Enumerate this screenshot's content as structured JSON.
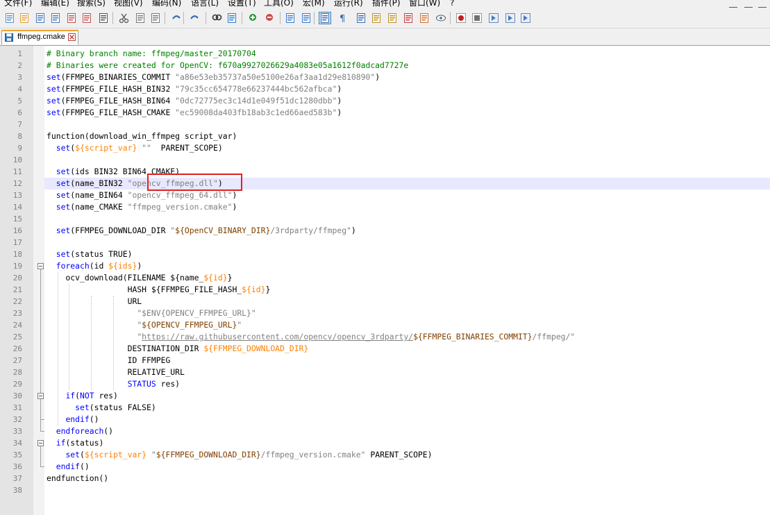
{
  "menu": [
    "文件(F)",
    "编辑(E)",
    "搜索(S)",
    "视图(V)",
    "编码(N)",
    "语言(L)",
    "设置(T)",
    "工具(O)",
    "宏(M)",
    "运行(R)",
    "插件(P)",
    "窗口(W)",
    "?"
  ],
  "toolbar_icons": [
    "new-file-icon",
    "open-file-icon",
    "save-icon",
    "save-all-icon",
    "close-icon",
    "close-all-icon",
    "print-icon",
    "cut-icon",
    "copy-icon",
    "paste-icon",
    "undo-icon",
    "redo-icon",
    "find-icon",
    "replace-icon",
    "zoom-in-icon",
    "zoom-out-icon",
    "sync-vertical-icon",
    "sync-horizontal-icon",
    "word-wrap-icon",
    "show-all-chars-icon",
    "indent-guide-icon",
    "udl-icon",
    "doc-map-icon",
    "function-list-icon",
    "folder-workspace-icon",
    "monitor-icon",
    "record-macro-icon",
    "stop-record-icon",
    "play-macro-icon",
    "play-multiple-icon",
    "save-macro-icon"
  ],
  "tab": {
    "label": "ffmpeg.cmake",
    "color_active": "#f0a030"
  },
  "colors": {
    "keyword": "#0000ff",
    "comment": "#008000",
    "string": "#808080",
    "variable": "#ff8000",
    "current_line": "#e8e8ff",
    "annotation_box": "#e02020"
  },
  "line_numbers": [
    "1",
    "2",
    "3",
    "4",
    "5",
    "6",
    "7",
    "8",
    "9",
    "10",
    "11",
    "12",
    "13",
    "14",
    "15",
    "16",
    "17",
    "18",
    "19",
    "20",
    "21",
    "22",
    "23",
    "24",
    "25",
    "26",
    "27",
    "28",
    "29",
    "30",
    "31",
    "32",
    "33",
    "34",
    "35",
    "36",
    "37",
    "38"
  ],
  "code_lines": [
    [
      [
        "cm",
        "# Binary branch name: ffmpeg/master_20170704"
      ]
    ],
    [
      [
        "cm",
        "# Binaries were created for OpenCV: f670a9927026629a4083e05a1612f0adcad7727e"
      ]
    ],
    [
      [
        "kw",
        "set"
      ],
      [
        "",
        "(FFMPEG_BINARIES_COMMIT "
      ],
      [
        "st",
        "\"a86e53eb35737a50e5100e26af3aa1d29e810890\""
      ],
      [
        "",
        ")"
      ]
    ],
    [
      [
        "kw",
        "set"
      ],
      [
        "",
        "(FFMPEG_FILE_HASH_BIN32 "
      ],
      [
        "st",
        "\"79c35cc654778e66237444bc562afbca\""
      ],
      [
        "",
        ")"
      ]
    ],
    [
      [
        "kw",
        "set"
      ],
      [
        "",
        "(FFMPEG_FILE_HASH_BIN64 "
      ],
      [
        "st",
        "\"0dc72775ec3c14d1e049f51dc1280dbb\""
      ],
      [
        "",
        ")"
      ]
    ],
    [
      [
        "kw",
        "set"
      ],
      [
        "",
        "(FFMPEG_FILE_HASH_CMAKE "
      ],
      [
        "st",
        "\"ec59008da403fb18ab3c1ed66aed583b\""
      ],
      [
        "",
        ")"
      ]
    ],
    [
      [
        "",
        ""
      ]
    ],
    [
      [
        "",
        "function(download_win_ffmpeg script_var)"
      ]
    ],
    [
      [
        "",
        "  "
      ],
      [
        "kw",
        "set"
      ],
      [
        "",
        "("
      ],
      [
        "vr",
        "${script_var}"
      ],
      [
        "st",
        " \"\""
      ],
      [
        "",
        ""
      ],
      [
        "",
        "  PARENT_SCOPE)"
      ]
    ],
    [
      [
        "",
        ""
      ]
    ],
    [
      [
        "",
        "  "
      ],
      [
        "kw",
        "set"
      ],
      [
        "",
        "(ids BIN32 BIN64 CMAKE)"
      ]
    ],
    [
      [
        "",
        "  "
      ],
      [
        "kw",
        "set"
      ],
      [
        "",
        "(name_BIN32 "
      ],
      [
        "st",
        "\"opencv_ffmpeg.dll\""
      ],
      [
        "",
        ")"
      ]
    ],
    [
      [
        "",
        "  "
      ],
      [
        "kw",
        "set"
      ],
      [
        "",
        "(name_BIN64 "
      ],
      [
        "st",
        "\"opencv_ffmpeg_64.dll\""
      ],
      [
        "",
        ")"
      ]
    ],
    [
      [
        "",
        "  "
      ],
      [
        "kw",
        "set"
      ],
      [
        "",
        "(name_CMAKE "
      ],
      [
        "st",
        "\"ffmpeg_version.cmake\""
      ],
      [
        "",
        ")"
      ]
    ],
    [
      [
        "",
        ""
      ]
    ],
    [
      [
        "",
        "  "
      ],
      [
        "kw",
        "set"
      ],
      [
        "",
        "(FFMPEG_DOWNLOAD_DIR "
      ],
      [
        "st",
        "\""
      ],
      [
        "bvr",
        "${OpenCV_BINARY_DIR}"
      ],
      [
        "st",
        "/3rdparty/ffmpeg\""
      ],
      [
        "",
        ")"
      ]
    ],
    [
      [
        "",
        ""
      ]
    ],
    [
      [
        "",
        "  "
      ],
      [
        "kw",
        "set"
      ],
      [
        "",
        "(status TRUE)"
      ]
    ],
    [
      [
        "",
        "  "
      ],
      [
        "kw",
        "foreach"
      ],
      [
        "",
        "(id "
      ],
      [
        "vr",
        "${ids}"
      ],
      [
        "",
        ")"
      ]
    ],
    [
      [
        "",
        "    ocv_download(FILENAME ${name_"
      ],
      [
        "vr",
        "${id}"
      ],
      [
        "",
        "}"
      ]
    ],
    [
      [
        "",
        "                 HASH ${FFMPEG_FILE_HASH_"
      ],
      [
        "vr",
        "${id}"
      ],
      [
        "",
        "}"
      ]
    ],
    [
      [
        "",
        "                 URL"
      ]
    ],
    [
      [
        "",
        "                   "
      ],
      [
        "st",
        "\"$ENV{OPENCV_FFMPEG_URL}\""
      ]
    ],
    [
      [
        "",
        "                   "
      ],
      [
        "st",
        "\""
      ],
      [
        "bvr",
        "${OPENCV_FFMPEG_URL}"
      ],
      [
        "st",
        "\""
      ]
    ],
    [
      [
        "",
        "                   "
      ],
      [
        "st",
        "\""
      ],
      [
        "st ul",
        "https://raw.githubusercontent.com/opencv/opencv_3rdparty/"
      ],
      [
        "bvr",
        "${FFMPEG_BINARIES_COMMIT}"
      ],
      [
        "st",
        "/ffmpeg/\""
      ]
    ],
    [
      [
        "",
        "                 DESTINATION_DIR "
      ],
      [
        "vr",
        "${FFMPEG_DOWNLOAD_DIR}"
      ]
    ],
    [
      [
        "",
        "                 ID FFMPEG"
      ]
    ],
    [
      [
        "",
        "                 RELATIVE_URL"
      ]
    ],
    [
      [
        "",
        "                 "
      ],
      [
        "kw",
        "STATUS"
      ],
      [
        "",
        ""
      ],
      [
        "",
        " res)"
      ]
    ],
    [
      [
        "",
        "    "
      ],
      [
        "kw",
        "if"
      ],
      [
        "",
        "("
      ],
      [
        "kw",
        "NOT"
      ],
      [
        "",
        ""
      ],
      [
        "",
        " res)"
      ]
    ],
    [
      [
        "",
        "      "
      ],
      [
        "kw",
        "set"
      ],
      [
        "",
        "(status FALSE)"
      ]
    ],
    [
      [
        "",
        "    "
      ],
      [
        "kw",
        "endif"
      ],
      [
        "",
        "()"
      ]
    ],
    [
      [
        "",
        "  "
      ],
      [
        "kw",
        "endforeach"
      ],
      [
        "",
        "()"
      ]
    ],
    [
      [
        "",
        "  "
      ],
      [
        "kw",
        "if"
      ],
      [
        "",
        "(status)"
      ]
    ],
    [
      [
        "",
        "    "
      ],
      [
        "kw",
        "set"
      ],
      [
        "",
        "("
      ],
      [
        "vr",
        "${script_var}"
      ],
      [
        "",
        " "
      ],
      [
        "st",
        "\""
      ],
      [
        "bvr",
        "${FFMPEG_DOWNLOAD_DIR}"
      ],
      [
        "st",
        "/ffmpeg_version.cmake\""
      ],
      [
        "",
        " PARENT_SCOPE)"
      ]
    ],
    [
      [
        "",
        "  "
      ],
      [
        "kw",
        "endif"
      ],
      [
        "",
        "()"
      ]
    ],
    [
      [
        "",
        "endfunction()"
      ]
    ],
    [
      [
        "",
        ""
      ]
    ]
  ]
}
